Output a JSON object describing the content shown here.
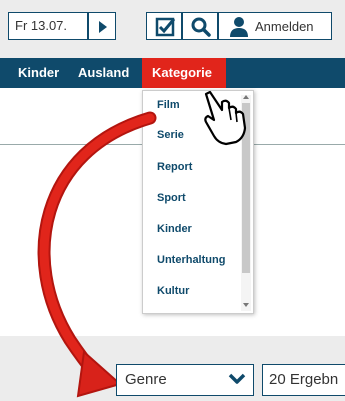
{
  "toolbar": {
    "date_label": "Fr 13.07.",
    "login_label": "Anmelden"
  },
  "nav": {
    "items": [
      {
        "label": "Kinder"
      },
      {
        "label": "Ausland"
      },
      {
        "label": "Kategorie"
      }
    ]
  },
  "dropdown": {
    "items": [
      "Film",
      "Serie",
      "Report",
      "Sport",
      "Kinder",
      "Unterhaltung",
      "Kultur"
    ]
  },
  "bottom": {
    "genre_value": "Genre",
    "results_label": "20 Ergebn"
  },
  "colors": {
    "brand": "#0f4a6b",
    "accent": "#e1251b"
  }
}
